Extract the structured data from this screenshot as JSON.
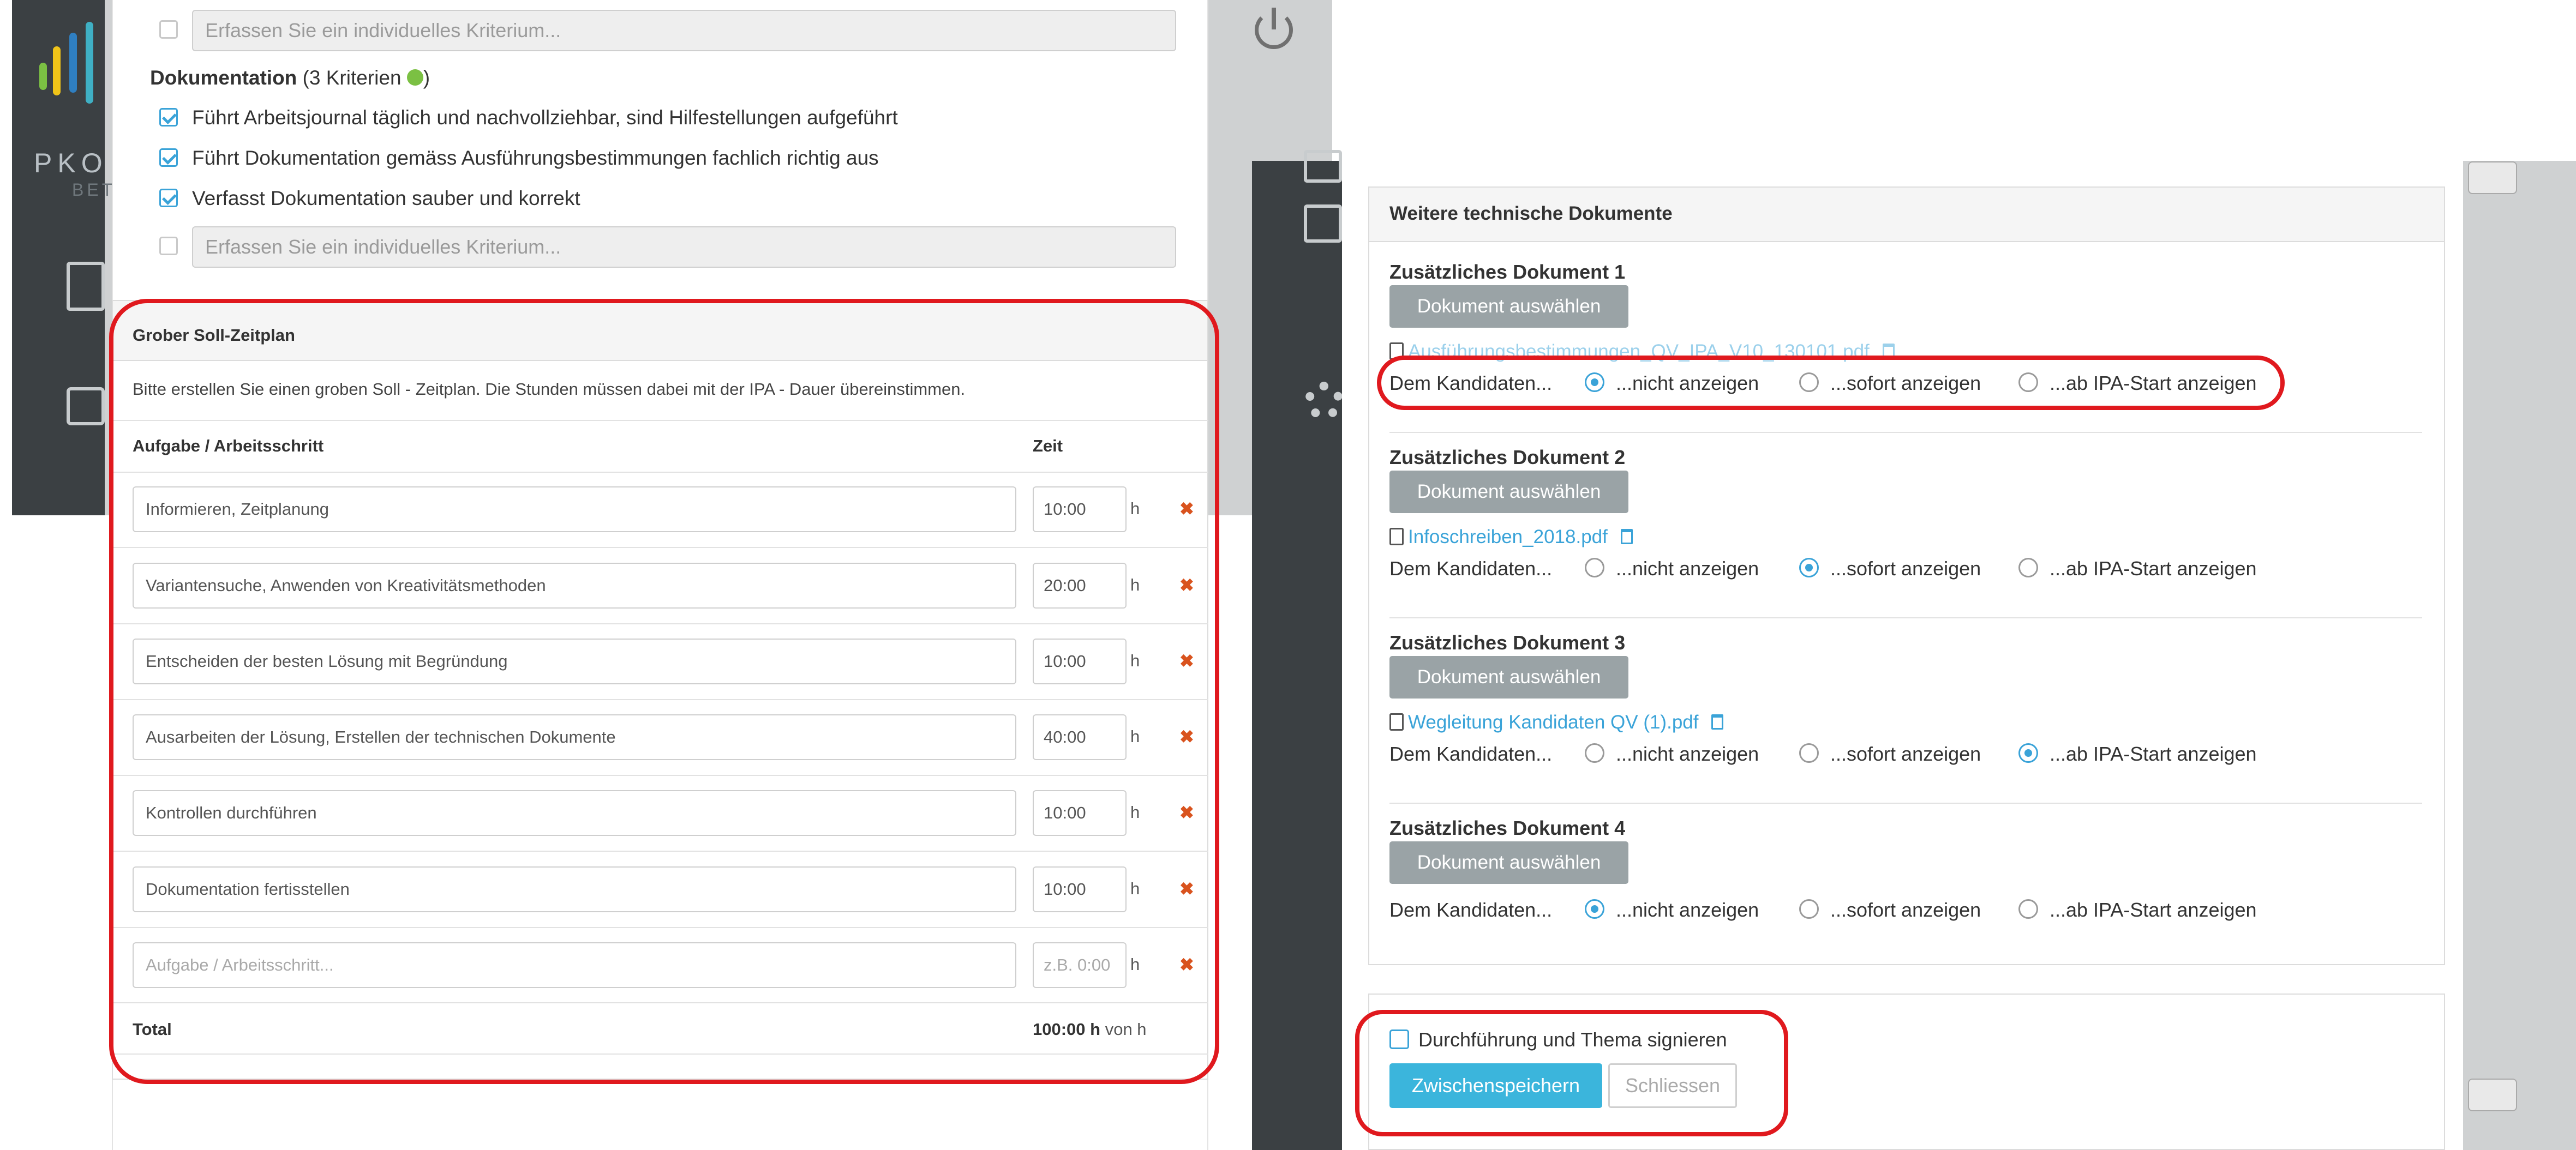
{
  "left_screen": {
    "logo": {
      "text": "PKO",
      "subtext": "BET"
    },
    "criteria_top": {
      "placeholder": "Erfassen Sie ein individuelles Kriterium..."
    },
    "dokumentation": {
      "title": "Dokumentation",
      "count": "(3 Kriterien",
      "close": ")",
      "items": [
        "Führt Arbeitsjournal täglich und nachvollziehbar, sind Hilfestellungen aufgeführt",
        "Führt Dokumentation gemäss Ausführungsbestimmungen fachlich richtig aus",
        "Verfasst Dokumentation sauber und korrekt"
      ],
      "placeholder": "Erfassen Sie ein individuelles Kriterium..."
    },
    "zeitplan": {
      "title": "Grober Soll-Zeitplan",
      "intro": "Bitte erstellen Sie einen groben Soll - Zeitplan. Die Stunden müssen dabei mit der IPA - Dauer übereinstimmen.",
      "col_task": "Aufgabe / Arbeitsschritt",
      "col_time": "Zeit",
      "unit": "h",
      "delete_symbol": "✖",
      "rows": [
        {
          "task": "Informieren, Zeitplanung",
          "time": "10:00"
        },
        {
          "task": "Variantensuche, Anwenden von Kreativitätsmethoden",
          "time": "20:00"
        },
        {
          "task": "Entscheiden der besten Lösung mit Begründung",
          "time": "10:00"
        },
        {
          "task": "Ausarbeiten der Lösung, Erstellen der technischen Dokumente",
          "time": "40:00"
        },
        {
          "task": "Kontrollen durchführen",
          "time": "10:00"
        },
        {
          "task": "Dokumentation fertisstellen",
          "time": "10:00"
        }
      ],
      "new_row": {
        "task_placeholder": "Aufgabe / Arbeitsschritt...",
        "time_placeholder": "z.B. 0:00"
      },
      "total_label": "Total",
      "total_value": "100:00 h",
      "total_suffix": "von h"
    }
  },
  "right_screen": {
    "section_title": "Weitere technische Dokumente",
    "button_label": "Dokument auswählen",
    "show_label": "Dem Kandidaten...",
    "options": [
      "...nicht anzeigen",
      "...sofort anzeigen",
      "...ab IPA-Start anzeigen"
    ],
    "documents": [
      {
        "title": "Zusätzliches Dokument 1",
        "file": "Ausführungsbestimmungen_QV_IPA_V10_130101.pdf",
        "selected": 0
      },
      {
        "title": "Zusätzliches Dokument 2",
        "file": "Infoschreiben_2018.pdf",
        "selected": 1
      },
      {
        "title": "Zusätzliches Dokument 3",
        "file": "Wegleitung Kandidaten QV (1).pdf",
        "selected": 2
      },
      {
        "title": "Zusätzliches Dokument 4",
        "file": "",
        "selected": 0
      }
    ],
    "sign": {
      "checkbox_label": "Durchführung und Thema signieren",
      "save": "Zwischenspeichern",
      "close": "Schliessen"
    }
  },
  "colors": {
    "accent": "#3aa3d8",
    "highlight": "#e0191e",
    "delete": "#d9531e",
    "success": "#7bc043"
  }
}
